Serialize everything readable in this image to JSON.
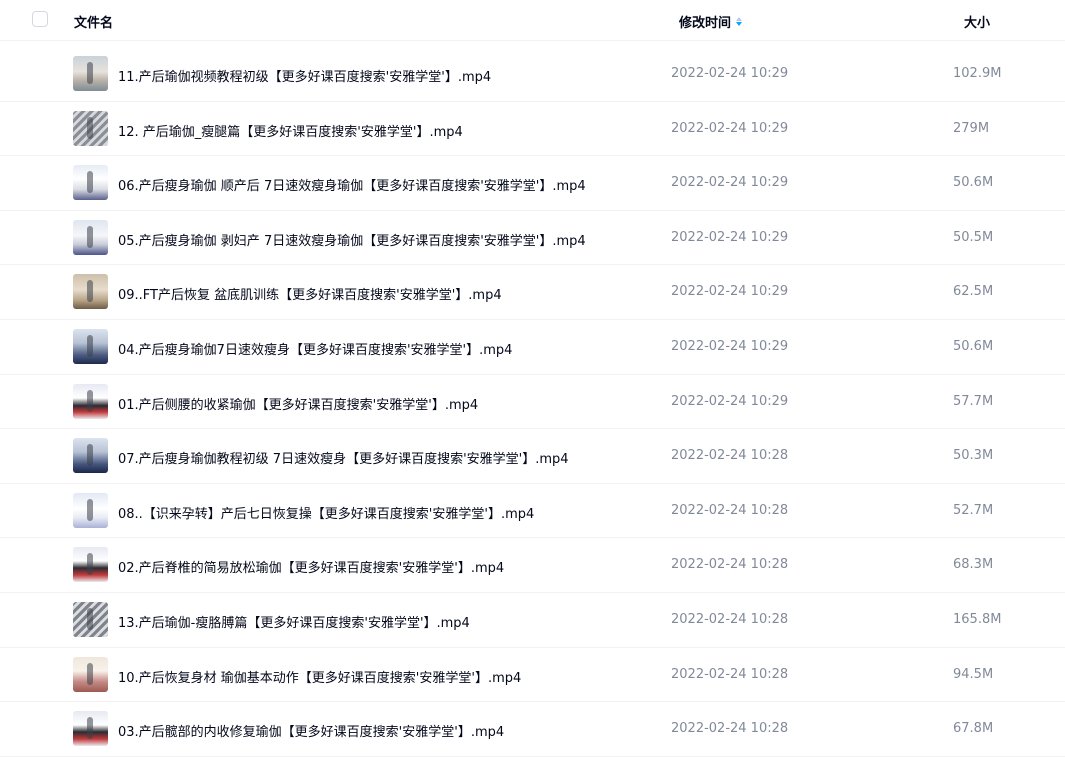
{
  "header": {
    "name_label": "文件名",
    "time_label": "修改时间",
    "size_label": "大小"
  },
  "files": [
    {
      "name": "11.产后瑜伽视频教程初级【更多好课百度搜索'安雅学堂'】.mp4",
      "time": "2022-02-24 10:29",
      "size": "102.9M",
      "thumb": "t-a"
    },
    {
      "name": "12. 产后瑜伽_瘦腿篇【更多好课百度搜索'安雅学堂'】.mp4",
      "time": "2022-02-24 10:29",
      "size": "279M",
      "thumb": "t-b"
    },
    {
      "name": "06.产后瘦身瑜伽 顺产后 7日速效瘦身瑜伽【更多好课百度搜索'安雅学堂'】.mp4",
      "time": "2022-02-24 10:29",
      "size": "50.6M",
      "thumb": "t-c"
    },
    {
      "name": "05.产后瘦身瑜伽 剥妇产 7日速效瘦身瑜伽【更多好课百度搜索'安雅学堂'】.mp4",
      "time": "2022-02-24 10:29",
      "size": "50.5M",
      "thumb": "t-d"
    },
    {
      "name": "09..FT产后恢复 盆底肌训练【更多好课百度搜索'安雅学堂'】.mp4",
      "time": "2022-02-24 10:29",
      "size": "62.5M",
      "thumb": "t-e"
    },
    {
      "name": "04.产后瘦身瑜伽7日速效瘦身【更多好课百度搜索'安雅学堂'】.mp4",
      "time": "2022-02-24 10:29",
      "size": "50.6M",
      "thumb": "t-f"
    },
    {
      "name": "01.产后侧腰的收紧瑜伽【更多好课百度搜索'安雅学堂'】.mp4",
      "time": "2022-02-24 10:29",
      "size": "57.7M",
      "thumb": "t-g"
    },
    {
      "name": "07.产后瘦身瑜伽教程初级 7日速效瘦身【更多好课百度搜索'安雅学堂'】.mp4",
      "time": "2022-02-24 10:28",
      "size": "50.3M",
      "thumb": "t-h"
    },
    {
      "name": "08..【识来孕转】产后七日恢复操【更多好课百度搜索'安雅学堂'】.mp4",
      "time": "2022-02-24 10:28",
      "size": "52.7M",
      "thumb": "t-i"
    },
    {
      "name": "02.产后脊椎的简易放松瑜伽【更多好课百度搜索'安雅学堂'】.mp4",
      "time": "2022-02-24 10:28",
      "size": "68.3M",
      "thumb": "t-j"
    },
    {
      "name": "13.产后瑜伽-瘦胳膊篇【更多好课百度搜索'安雅学堂'】.mp4",
      "time": "2022-02-24 10:28",
      "size": "165.8M",
      "thumb": "t-k"
    },
    {
      "name": "10.产后恢复身材 瑜伽基本动作【更多好课百度搜索'安雅学堂'】.mp4",
      "time": "2022-02-24 10:28",
      "size": "94.5M",
      "thumb": "t-l"
    },
    {
      "name": "03.产后髋部的内收修复瑜伽【更多好课百度搜索'安雅学堂'】.mp4",
      "time": "2022-02-24 10:28",
      "size": "67.8M",
      "thumb": "t-m"
    }
  ],
  "colors": {
    "text_primary": "#03081a",
    "text_secondary": "#818999",
    "divider": "#f2f2f4",
    "sort_accent": "#06a7ff"
  },
  "icons": {
    "select_all": "checkbox-icon",
    "sort": "sort-desc-icon"
  }
}
